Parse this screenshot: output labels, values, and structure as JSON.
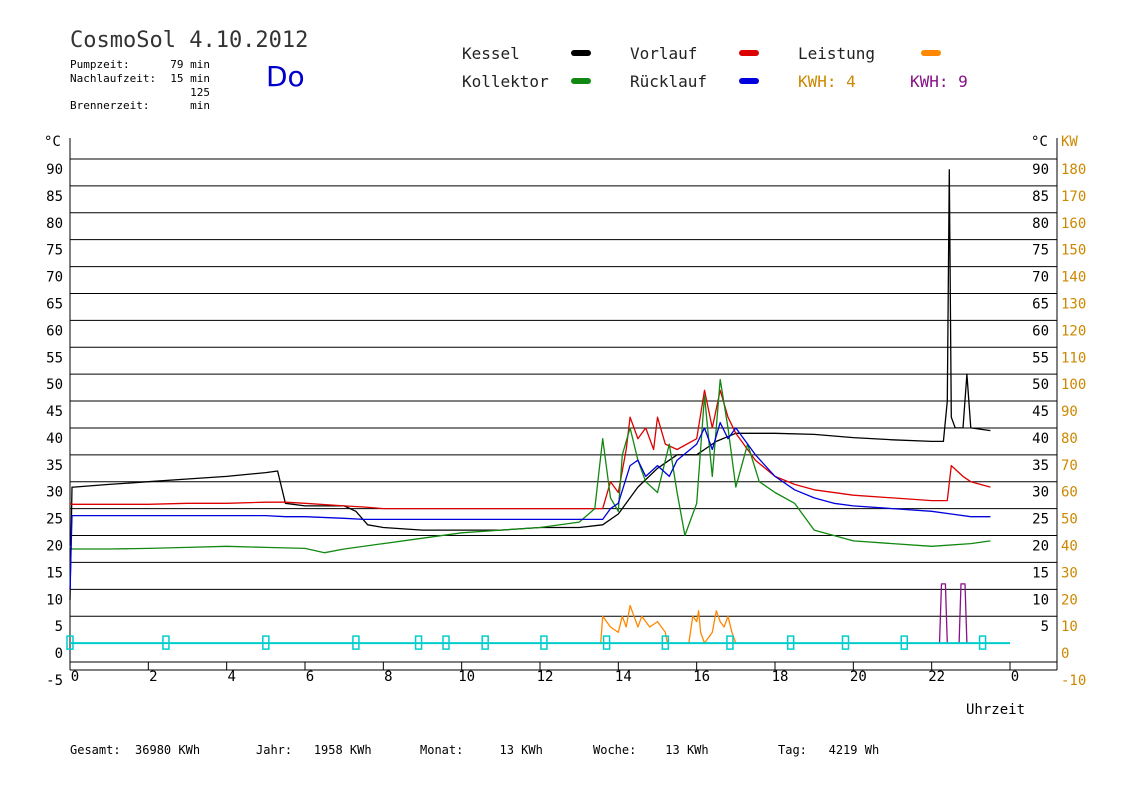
{
  "header": {
    "title": "CosmoSol 4.10.2012",
    "day": "Do",
    "stats": [
      {
        "label": "Pumpzeit:",
        "value": "79 min"
      },
      {
        "label": "Nachlaufzeit:",
        "value": "15 min"
      },
      {
        "label": "Brennerzeit:",
        "value": "125 min"
      }
    ]
  },
  "legend": [
    {
      "name": "Kessel",
      "color": "#000000"
    },
    {
      "name": "Vorlauf",
      "color": "#dd0000"
    },
    {
      "name": "Leistung",
      "color": "#ff8800"
    },
    {
      "name": "Kollektor",
      "color": "#118811"
    },
    {
      "name": "Rücklauf",
      "color": "#0000dd"
    }
  ],
  "kwh": [
    {
      "label": "KWH: 4",
      "color": "#cc8800"
    },
    {
      "label": "KWH: 9",
      "color": "#881188"
    }
  ],
  "footer": [
    {
      "label": "Gesamt:",
      "value": "36980 KWh"
    },
    {
      "label": "Jahr:",
      "value": "1958 KWh"
    },
    {
      "label": "Monat:",
      "value": "13 KWh"
    },
    {
      "label": "Woche:",
      "value": "13 KWh"
    },
    {
      "label": "Tag:",
      "value": "4219 Wh"
    }
  ],
  "chart_data": {
    "type": "line",
    "xlabel": "Uhrzeit",
    "ylabel_left": "°C",
    "ylabel_right_temp": "°C",
    "ylabel_right_power": "KW",
    "xlim": [
      0,
      24
    ],
    "ylim": [
      -5,
      90
    ],
    "y_ticks_left": [
      -5,
      0,
      5,
      10,
      15,
      20,
      25,
      30,
      35,
      40,
      45,
      50,
      55,
      60,
      65,
      70,
      75,
      80,
      85,
      90
    ],
    "y_ticks_right_temp": [
      5,
      10,
      15,
      20,
      25,
      30,
      35,
      40,
      45,
      50,
      55,
      60,
      65,
      70,
      75,
      80,
      85,
      90
    ],
    "y_ticks_right_kw": [
      -10,
      0,
      10,
      20,
      30,
      40,
      50,
      60,
      70,
      80,
      90,
      100,
      110,
      120,
      130,
      140,
      150,
      160,
      170,
      180
    ],
    "x_ticks": [
      "0",
      "2",
      "4",
      "6",
      "8",
      "10",
      "12",
      "14",
      "16",
      "18",
      "20",
      "22",
      "0"
    ],
    "grid": true,
    "series": [
      {
        "name": "Kessel",
        "color": "#000000",
        "x": [
          0,
          0.05,
          0.1,
          1,
          2,
          3,
          4,
          5,
          5.3,
          5.5,
          6,
          7,
          7.3,
          7.6,
          8,
          9,
          10,
          11,
          12,
          13,
          13.6,
          14,
          14.5,
          15,
          15.5,
          16,
          16.5,
          17,
          18,
          19,
          20,
          21,
          22,
          22.3,
          22.4,
          22.45,
          22.5,
          22.6,
          22.8,
          22.9,
          23,
          23.5
        ],
        "y": [
          8,
          29,
          29,
          29.5,
          30,
          30.5,
          31,
          31.7,
          32,
          26,
          25.5,
          25.5,
          24.5,
          22,
          21.5,
          21,
          21,
          21,
          21.5,
          21.5,
          22,
          24,
          29,
          32.5,
          35,
          35,
          37.5,
          39,
          39,
          38.8,
          38.2,
          37.8,
          37.5,
          37.5,
          45,
          88,
          42,
          40,
          40,
          50,
          40,
          39.5
        ]
      },
      {
        "name": "Vorlauf",
        "color": "#dd0000",
        "x": [
          0,
          0.05,
          1,
          2,
          3,
          4,
          5,
          5.5,
          6,
          7,
          7.5,
          8,
          9,
          10,
          11,
          12,
          13,
          13.6,
          13.8,
          14,
          14.2,
          14.3,
          14.5,
          14.7,
          14.9,
          15,
          15.2,
          15.5,
          16,
          16.2,
          16.4,
          16.6,
          16.8,
          17,
          17.5,
          18,
          18.5,
          19,
          20,
          21,
          22,
          22.3,
          22.4,
          22.5,
          22.8,
          23,
          23.5
        ],
        "y": [
          26,
          25.8,
          25.8,
          25.8,
          26,
          26,
          26.2,
          26.2,
          26,
          25.5,
          25.3,
          25,
          25,
          25,
          25,
          25,
          25,
          25,
          30,
          28,
          36,
          42,
          38,
          40,
          36,
          42,
          37,
          36,
          38,
          47,
          40,
          47,
          42,
          39,
          34,
          31,
          29.5,
          28.5,
          27.5,
          27,
          26.5,
          26.5,
          26.5,
          33,
          31,
          30,
          29
        ]
      },
      {
        "name": "Kollektor",
        "color": "#118811",
        "x": [
          0,
          0.05,
          1,
          2,
          3,
          4,
          5,
          6,
          6.5,
          7,
          8,
          9,
          10,
          11,
          12,
          13,
          13.4,
          13.6,
          13.8,
          14,
          14.1,
          14.3,
          14.5,
          14.7,
          15,
          15.3,
          15.5,
          15.7,
          16,
          16.2,
          16.4,
          16.6,
          16.8,
          17,
          17.3,
          17.6,
          18,
          18.5,
          19,
          19.5,
          20,
          21,
          22,
          23,
          23.5
        ],
        "y": [
          18,
          17.5,
          17.5,
          17.6,
          17.8,
          18,
          17.8,
          17.6,
          16.8,
          17.5,
          18.5,
          19.5,
          20.5,
          21,
          21.5,
          22.5,
          25,
          38,
          27,
          24.5,
          35,
          40,
          34,
          30,
          28,
          37,
          28,
          20,
          26,
          46,
          31,
          49,
          40,
          29,
          37,
          30,
          28,
          26,
          21,
          20,
          19,
          18.5,
          18,
          18.5,
          19
        ]
      },
      {
        "name": "Rücklauf",
        "color": "#0000dd",
        "x": [
          0,
          0.05,
          1,
          2,
          3,
          4,
          5,
          5.5,
          6,
          7,
          7.5,
          8,
          9,
          10,
          11,
          12,
          13,
          13.6,
          13.8,
          14,
          14.3,
          14.5,
          14.7,
          15,
          15.3,
          15.5,
          16,
          16.2,
          16.4,
          16.6,
          16.8,
          17,
          17.5,
          18,
          18.5,
          19,
          19.5,
          20,
          21,
          22,
          22.5,
          23,
          23.5
        ],
        "y": [
          10,
          23.7,
          23.7,
          23.7,
          23.7,
          23.7,
          23.7,
          23.5,
          23.5,
          23.2,
          23,
          23,
          23,
          23,
          23,
          23,
          23,
          23,
          25,
          26,
          33,
          34,
          31,
          33,
          31,
          34,
          37,
          40,
          36,
          41,
          38,
          40,
          35,
          31,
          28.5,
          27,
          26,
          25.5,
          25,
          24.5,
          24,
          23.5,
          23.5
        ]
      },
      {
        "name": "Leistung",
        "color": "#ff8800",
        "x": [
          13.55,
          13.6,
          13.8,
          14,
          14.1,
          14.2,
          14.3,
          14.5,
          14.6,
          14.8,
          15,
          15.2,
          15.25,
          15.8,
          15.9,
          16,
          16.05,
          16.1,
          16.2,
          16.4,
          16.5,
          16.6,
          16.7,
          16.8,
          16.9,
          17
        ],
        "y": [
          0,
          5,
          3,
          2,
          5,
          3,
          7,
          3,
          5,
          3,
          4,
          2,
          0,
          0,
          5,
          4,
          6,
          2,
          0,
          2,
          6,
          4,
          3,
          5,
          2,
          0
        ]
      },
      {
        "name": "KWH 9 (Zusatz)",
        "color": "#881188",
        "x": [
          22.2,
          22.25,
          22.35,
          22.4,
          22.7,
          22.75,
          22.85,
          22.9
        ],
        "y": [
          0,
          11,
          11,
          0,
          0,
          11,
          11,
          0
        ]
      },
      {
        "name": "Pumpe",
        "color": "#00cccc",
        "x": [
          0,
          2.45,
          5,
          7.3,
          8.9,
          9.6,
          10.6,
          12.1,
          13.7,
          15.2,
          16.85,
          18.4,
          19.8,
          21.3,
          23.3
        ],
        "y": [
          0,
          0,
          0,
          0,
          0,
          0,
          0,
          0,
          0,
          0,
          0,
          0,
          0,
          0,
          0
        ]
      }
    ]
  }
}
